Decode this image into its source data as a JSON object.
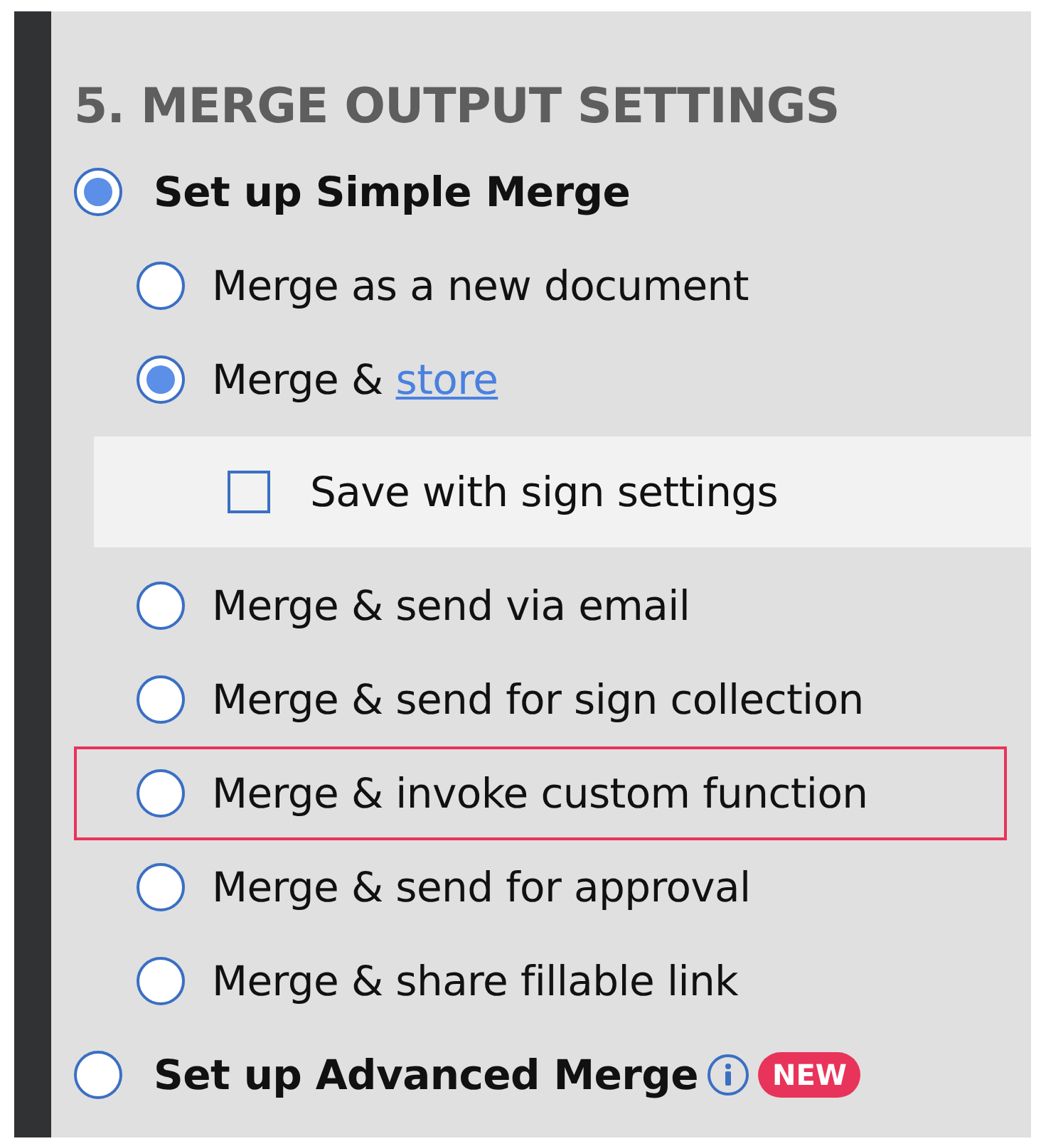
{
  "heading": "5. MERGE OUTPUT SETTINGS",
  "options": [
    {
      "kind": "radio",
      "label": "Set up Simple Merge",
      "selected": true,
      "children": [
        {
          "kind": "radio",
          "label": "Merge as a new document",
          "selected": false
        },
        {
          "kind": "radio",
          "label": "Merge &",
          "link": "store",
          "selected": true,
          "children": [
            {
              "kind": "checkbox",
              "label": "Save with sign settings",
              "checked": false
            }
          ]
        },
        {
          "kind": "radio",
          "label": "Merge & send via email",
          "selected": false
        },
        {
          "kind": "radio",
          "label": "Merge & send for sign collection",
          "selected": false
        },
        {
          "kind": "radio",
          "label": "Merge & invoke custom function",
          "selected": false,
          "highlighted": true
        },
        {
          "kind": "radio",
          "label": "Merge & send for approval",
          "selected": false
        },
        {
          "kind": "radio",
          "label": "Merge & share fillable link",
          "selected": false
        }
      ]
    },
    {
      "kind": "radio",
      "label": "Set up Advanced Merge",
      "selected": false,
      "info": true,
      "badge": "NEW"
    }
  ]
}
